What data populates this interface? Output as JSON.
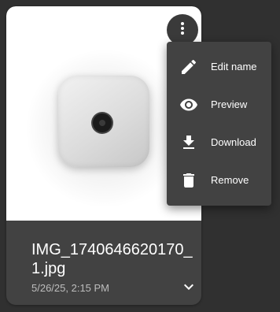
{
  "card": {
    "file_name": "IMG_1740646620170_1.jpg",
    "date": "5/26/25, 2:15 PM",
    "more_icon": "more-vert-icon",
    "expand_icon": "chevron-down-icon"
  },
  "menu": {
    "items": [
      {
        "label": "Edit name",
        "icon": "pencil-icon"
      },
      {
        "label": "Preview",
        "icon": "eye-icon"
      },
      {
        "label": "Download",
        "icon": "download-icon"
      },
      {
        "label": "Remove",
        "icon": "trash-icon"
      }
    ]
  },
  "colors": {
    "background": "#303030",
    "card": "#424242",
    "menu": "#424242",
    "text_primary": "#ffffff",
    "text_secondary": "#bdbdbd"
  }
}
